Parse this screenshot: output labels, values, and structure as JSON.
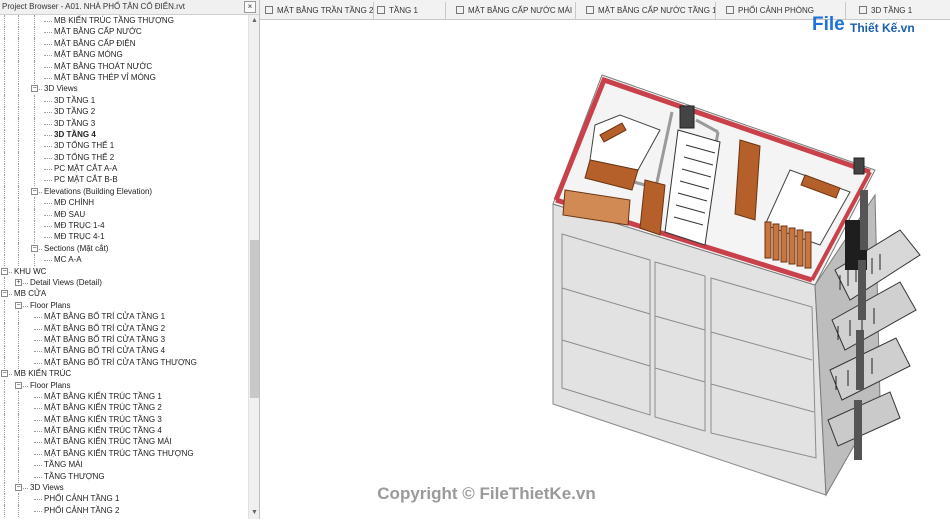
{
  "browser": {
    "title": "Project Browser - A01. NHÀ PHỐ TÂN CỔ ĐIỂN.rvt",
    "close_label": "×"
  },
  "tree": [
    {
      "label": "MB KIẾN TRÚC TẦNG THƯỢNG"
    },
    {
      "label": "MẶT BẰNG CẤP NƯỚC"
    },
    {
      "label": "MẶT BẰNG CẤP ĐIỆN"
    },
    {
      "label": "MẶT BẰNG MÓNG"
    },
    {
      "label": "MẶT BẰNG THOÁT NƯỚC"
    },
    {
      "label": "MẶT BẰNG THÉP VỈ MÓNG"
    },
    {
      "label": "3D Views",
      "expander": "−"
    },
    {
      "label": "3D TẦNG 1"
    },
    {
      "label": "3D TẦNG 2"
    },
    {
      "label": "3D TẦNG 3"
    },
    {
      "label": "3D TẦNG 4",
      "bold": true
    },
    {
      "label": "3D TỔNG THỂ 1"
    },
    {
      "label": "3D TỔNG THỂ 2"
    },
    {
      "label": "PC MẶT CẮT A-A"
    },
    {
      "label": "PC MẶT CẮT B-B"
    },
    {
      "label": "Elevations (Building Elevation)",
      "expander": "−"
    },
    {
      "label": "MĐ CHÍNH"
    },
    {
      "label": "MĐ SAU"
    },
    {
      "label": "MĐ TRỤC 1-4"
    },
    {
      "label": "MĐ TRỤC 4-1"
    },
    {
      "label": "Sections (Mặt cắt)",
      "expander": "−"
    },
    {
      "label": "MC A-A"
    },
    {
      "label": "KHU WC",
      "expander": "−"
    },
    {
      "label": "Detail Views (Detail)",
      "expander": "+"
    },
    {
      "label": "MB CỬA",
      "expander": "−"
    },
    {
      "label": "Floor Plans",
      "expander": "−"
    },
    {
      "label": "MẶT BẰNG BỐ TRÍ CỬA TẦNG 1"
    },
    {
      "label": "MẶT BẰNG BỐ TRÍ CỬA TẦNG 2"
    },
    {
      "label": "MẶT BẰNG BỐ TRÍ CỬA TẦNG 3"
    },
    {
      "label": "MẶT BẰNG BỐ TRÍ CỬA TẦNG 4"
    },
    {
      "label": "MẶT BẰNG BỐ TRÍ CỬA TẦNG THƯỢNG"
    },
    {
      "label": "MB KIẾN TRÚC",
      "expander": "−"
    },
    {
      "label": "Floor Plans",
      "expander": "−"
    },
    {
      "label": "MẶT BẰNG KIẾN TRÚC TẦNG 1"
    },
    {
      "label": "MẶT BẰNG KIẾN TRÚC TẦNG 2"
    },
    {
      "label": "MẶT BẰNG KIẾN TRÚC TẦNG 3"
    },
    {
      "label": "MẶT BẰNG KIẾN TRÚC TẦNG 4"
    },
    {
      "label": "MẶT BẰNG KIẾN TRÚC TẦNG MÁI"
    },
    {
      "label": "MẶT BẰNG KIẾN TRÚC TẦNG THƯỢNG"
    },
    {
      "label": "TẦNG MÁI"
    },
    {
      "label": "TẦNG THƯỢNG"
    },
    {
      "label": "3D Views",
      "expander": "−"
    },
    {
      "label": "PHỐI CẢNH TẦNG 1"
    },
    {
      "label": "PHỐI CẢNH TẦNG 2"
    }
  ],
  "tabs": [
    {
      "label": "MẶT BẰNG TRẦN TẦNG 2"
    },
    {
      "label": "TẦNG 1"
    },
    {
      "label": "MẶT BẰNG CẤP NƯỚC MÁI"
    },
    {
      "label": "MẶT BẰNG CẤP NƯỚC TẦNG 1"
    },
    {
      "label": "PHỐI CẢNH PHÒNG"
    },
    {
      "label": "3D TẦNG 1"
    }
  ],
  "logo": {
    "file_text": "File",
    "brand_text": "Thiết Kế.vn"
  },
  "watermark": "Copyright © FileThietKe.vn",
  "colors": {
    "wall_top": "#c8414b",
    "furniture": "#b5602a",
    "facade": "#e2e2e2",
    "accent": "#1e73d8"
  },
  "icons": {
    "tab_view": "view-icon",
    "close": "close-icon"
  }
}
